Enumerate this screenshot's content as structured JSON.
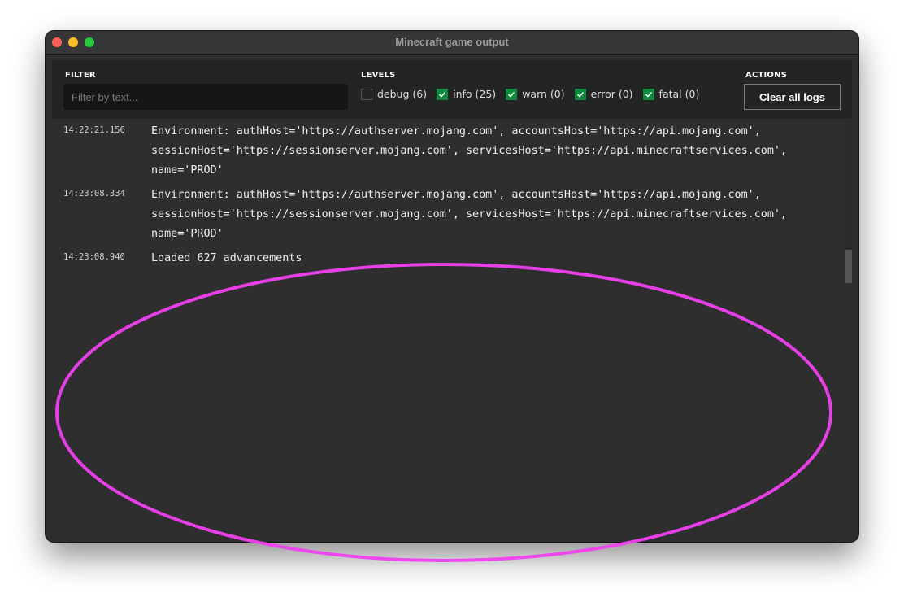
{
  "window": {
    "title": "Minecraft game output"
  },
  "filter": {
    "label": "FILTER",
    "placeholder": "Filter by text...",
    "value": ""
  },
  "levels": {
    "label": "LEVELS",
    "items": [
      {
        "label": "debug (6)",
        "checked": false
      },
      {
        "label": "info (25)",
        "checked": true
      },
      {
        "label": "warn (0)",
        "checked": true
      },
      {
        "label": "error (0)",
        "checked": true
      },
      {
        "label": "fatal (0)",
        "checked": true
      }
    ]
  },
  "actions": {
    "label": "ACTIONS",
    "clear_label": "Clear all logs"
  },
  "logs": [
    {
      "time": "14:22:21.156",
      "message": "Environment: authHost='https://authserver.mojang.com', accountsHost='https://api.mojang.com', sessionHost='https://sessionserver.mojang.com', servicesHost='https://api.minecraftservices.com', name='PROD'"
    },
    {
      "time": "14:23:08.334",
      "message": "Environment: authHost='https://authserver.mojang.com', accountsHost='https://api.mojang.com', sessionHost='https://sessionserver.mojang.com', servicesHost='https://api.minecraftservices.com', name='PROD'"
    },
    {
      "time": "14:23:08.940",
      "message": "Loaded 627 advancements"
    }
  ],
  "colors": {
    "accent": "#0e8a3c",
    "annotation": "#f040f0"
  }
}
